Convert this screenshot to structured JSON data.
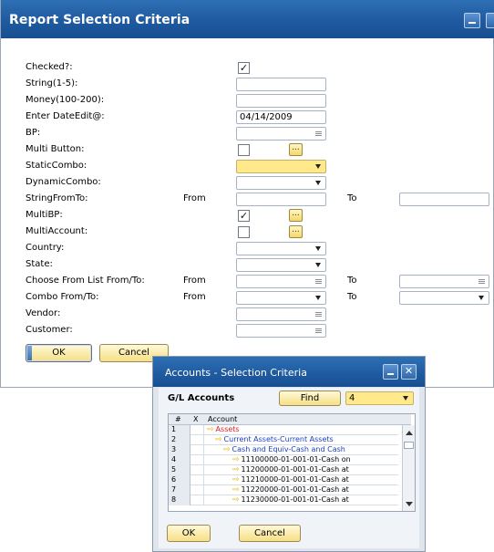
{
  "window": {
    "title": "Report Selection Criteria"
  },
  "form": {
    "checked_label": "Checked?:",
    "string_label": "String(1-5):",
    "money_label": "Money(100-200):",
    "date_label": "Enter DateEdit@:",
    "date_value": "04/14/2009",
    "bp_label": "BP:",
    "multibutton_label": "Multi Button:",
    "staticcombo_label": "StaticCombo:",
    "dynamiccombo_label": "DynamicCombo:",
    "stringfromto_label": "StringFromTo:",
    "multibp_label": "MultiBP:",
    "multiaccount_label": "MultiAccount:",
    "country_label": "Country:",
    "state_label": "State:",
    "cfl_fromto_label": "Choose From List From/To:",
    "combo_fromto_label": "Combo From/To:",
    "vendor_label": "Vendor:",
    "customer_label": "Customer:",
    "from_text": "From",
    "to_text": "To",
    "dots_glyph": "...",
    "check_glyph": "✓",
    "ok_label": "OK",
    "cancel_label": "Cancel",
    "accent_yellow": "#ffe98a"
  },
  "popup": {
    "title": "Accounts - Selection Criteria",
    "section_title": "G/L Accounts",
    "find_label": "Find",
    "level_value": "4",
    "col_num": "#",
    "col_x": "X",
    "col_account": "Account",
    "rows": [
      {
        "num": "1",
        "account": "Assets",
        "color": "#e02020"
      },
      {
        "num": "2",
        "account": "Current Assets-Current Assets",
        "color": "#1a3fc4"
      },
      {
        "num": "3",
        "account": "Cash and Equiv-Cash and Cash",
        "color": "#1a3fc4"
      },
      {
        "num": "4",
        "account": "11100000-01-001-01-Cash on",
        "color": "#000000"
      },
      {
        "num": "5",
        "account": "11200000-01-001-01-Cash at",
        "color": "#000000"
      },
      {
        "num": "6",
        "account": "11210000-01-001-01-Cash at",
        "color": "#000000"
      },
      {
        "num": "7",
        "account": "11220000-01-001-01-Cash at",
        "color": "#000000"
      },
      {
        "num": "8",
        "account": "11230000-01-001-01-Cash at",
        "color": "#000000"
      }
    ],
    "ok_label": "OK",
    "cancel_label": "Cancel",
    "close_glyph": "✕"
  }
}
